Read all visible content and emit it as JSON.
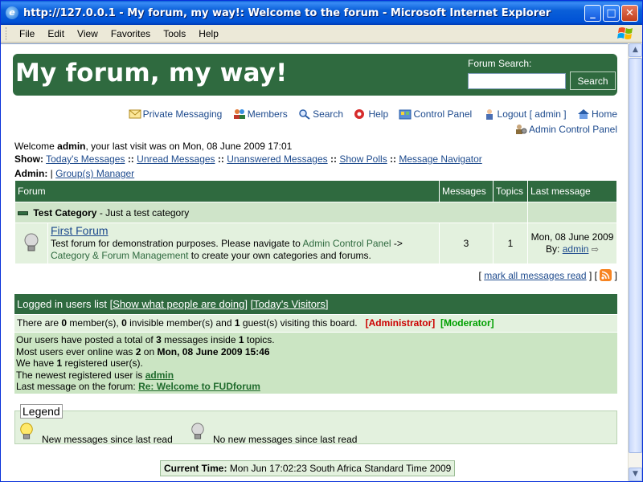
{
  "window": {
    "title": "http://127.0.0.1 - My forum, my way!: Welcome to the forum - Microsoft Internet Explorer",
    "min_label": "_",
    "max_label": "□",
    "close_label": "✕"
  },
  "menu": [
    "File",
    "Edit",
    "View",
    "Favorites",
    "Tools",
    "Help"
  ],
  "header": {
    "site_name": "My forum, my way!",
    "search_label": "Forum Search:",
    "search_value": "",
    "search_button": "Search"
  },
  "nav": {
    "private_messaging": "Private Messaging",
    "members": "Members",
    "search": "Search",
    "help": "Help",
    "control_panel": "Control Panel",
    "logout": "Logout",
    "logout_user_open": "[",
    "logout_user": "admin",
    "logout_user_close": "]",
    "home": "Home",
    "admin_control_panel": "Admin Control Panel"
  },
  "welcome": {
    "prefix": "Welcome",
    "user": "admin",
    "suffix": ", your last visit was on Mon, 08 June 2009 17:01"
  },
  "show": {
    "label": "Show:",
    "sep": "::",
    "links": [
      "Today's Messages",
      "Unread Messages",
      "Unanswered Messages",
      "Show Polls",
      "Message Navigator"
    ]
  },
  "admin_row": {
    "label": "Admin:",
    "sep": "|",
    "link": "Group(s) Manager"
  },
  "forum_table": {
    "headers": [
      "Forum",
      "Messages",
      "Topics",
      "Last message"
    ],
    "category": {
      "name": "Test Category",
      "description": "- Just a test category"
    },
    "forum": {
      "name": "First Forum",
      "desc_1": "Test forum for demonstration purposes. Please navigate to",
      "desc_link_1": "Admin Control Panel",
      "desc_arrow": "->",
      "desc_link_2": "Category & Forum Management",
      "desc_2": "to create your own categories and forums.",
      "messages": "3",
      "topics": "1",
      "last_date": "Mon, 08 June 2009",
      "last_by_label": "By:",
      "last_by": "admin"
    }
  },
  "mark_read": {
    "open": "[",
    "link": "mark all messages read",
    "mid": "] [",
    "close": "]"
  },
  "online": {
    "title": "Logged in users list",
    "link_1": "[Show what people are doing]",
    "link_2": "[Today's Visitors]",
    "members_line_1": "There are",
    "members_count": "0",
    "members_line_2": "member(s),",
    "invisible_count": "0",
    "members_line_3": "invisible member(s) and",
    "guests_count": "1",
    "members_line_4": "guest(s) visiting this board.",
    "admin_tag": "[Administrator]",
    "mod_tag": "[Moderator]"
  },
  "stats": {
    "line1_a": "Our users have posted a total of",
    "line1_msgs": "3",
    "line1_b": "messages inside",
    "line1_topics": "1",
    "line1_c": "topics.",
    "line2_a": "Most users ever online was",
    "line2_count": "2",
    "line2_b": "on",
    "line2_date": "Mon, 08 June 2009 15:46",
    "line3_a": "We have",
    "line3_count": "1",
    "line3_b": "registered user(s).",
    "line4_a": "The newest registered user is",
    "line4_user": "admin",
    "line5_a": "Last message on the forum:",
    "line5_link": "Re: Welcome to FUDforum"
  },
  "legend": {
    "title": "Legend",
    "new": "New messages since last read",
    "none": "No new messages since last read"
  },
  "footer": {
    "label": "Current Time:",
    "value": "Mon Jun 17:02:23 South Africa Standard Time 2009"
  },
  "colors": {
    "forum_green": "#2f6a3f",
    "category_bg": "#cfe4c9",
    "row_bg": "#e3f1de",
    "link_blue": "#1d4a8d",
    "admin_red": "#cc0000",
    "mod_green": "#00a000"
  }
}
